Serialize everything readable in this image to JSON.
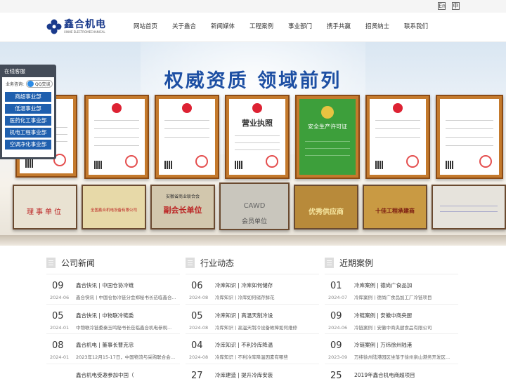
{
  "lang": {
    "en": "En",
    "cn": "中"
  },
  "logo": {
    "cn": "鑫合机电",
    "en": "XINHE ELECTROMECHANICAL"
  },
  "nav": [
    "网站首页",
    "关于鑫合",
    "新闻媒体",
    "工程案例",
    "事业部门",
    "携手共赢",
    "招贤纳士",
    "联系我们"
  ],
  "banner": {
    "title": "权威资质 领域前列",
    "certs": [
      "营业执照",
      "安全生产许可证"
    ],
    "plaques": [
      "理事单位",
      "全国鑫合机电设备有限公司",
      "副会长单位",
      "CAWD",
      "会员单位",
      "优秀供应商",
      "十佳工程承建商",
      "安徽省商业联合会"
    ]
  },
  "float": {
    "header": "在线客服",
    "contact_label": "业务咨询:",
    "qq_label": "QQ交谈",
    "buttons": [
      "商超事业部",
      "低温事业部",
      "医药化工事业部",
      "机电工程事业部",
      "空调净化事业部"
    ]
  },
  "columns": [
    {
      "title": "公司新闻",
      "items": [
        {
          "day": "09",
          "ym": "2024-06",
          "title": "鑫合快讯 | 中国仓协冷链",
          "desc": "鑫合快讯丨中国仓协冷链分会郑秘书长莅临鑫合..."
        },
        {
          "day": "05",
          "ym": "2024-01",
          "title": "鑫合快讯 | 中物联冷链委",
          "desc": "中物联冷链委秦玉鸣秘书长莅临鑫合机电参观..."
        },
        {
          "day": "08",
          "ym": "2024-01",
          "title": "鑫合机电 | 董事长曹克忠",
          "desc": "2023年12月15-17日，中国物流与采购联合会冷..."
        },
        {
          "day": "",
          "ym": "",
          "title": "鑫合机电受邀参加中国（",
          "desc": ""
        }
      ]
    },
    {
      "title": "行业动态",
      "items": [
        {
          "day": "06",
          "ym": "2024-08",
          "title": "冷库知识 | 冷库如何储存",
          "desc": "冷库知识丨冷库如何储存鲜花"
        },
        {
          "day": "05",
          "ym": "2024-08",
          "title": "冷库知识 | 高温天制冷设",
          "desc": "冷库知识丨高温天制冷设备故障如何维修"
        },
        {
          "day": "04",
          "ym": "2024-08",
          "title": "冷库知识 | 不利冷库降温",
          "desc": "冷库知识丨不利冷库降温因素有哪些"
        },
        {
          "day": "27",
          "ym": "",
          "title": "冷库建造 | 提升冷库安装",
          "desc": ""
        }
      ]
    },
    {
      "title": "近期案例",
      "items": [
        {
          "day": "01",
          "ym": "2024-07",
          "title": "冷库案例 | 德尚广食品加",
          "desc": "冷库案例丨德尚广食品加工厂冷链项目"
        },
        {
          "day": "09",
          "ym": "2024-06",
          "title": "冷链案例 | 安徽中商央厨",
          "desc": "冷链案例丨安徽中商央厨食品有限公司"
        },
        {
          "day": "09",
          "ym": "2023-09",
          "title": "冷链案例 | 万纬徐州陆港",
          "desc": "万纬徐州陆港园区坐落于徐州泉山港务开发区..."
        },
        {
          "day": "25",
          "ym": "",
          "title": "2019年鑫合机电商超项目",
          "desc": ""
        }
      ]
    }
  ]
}
